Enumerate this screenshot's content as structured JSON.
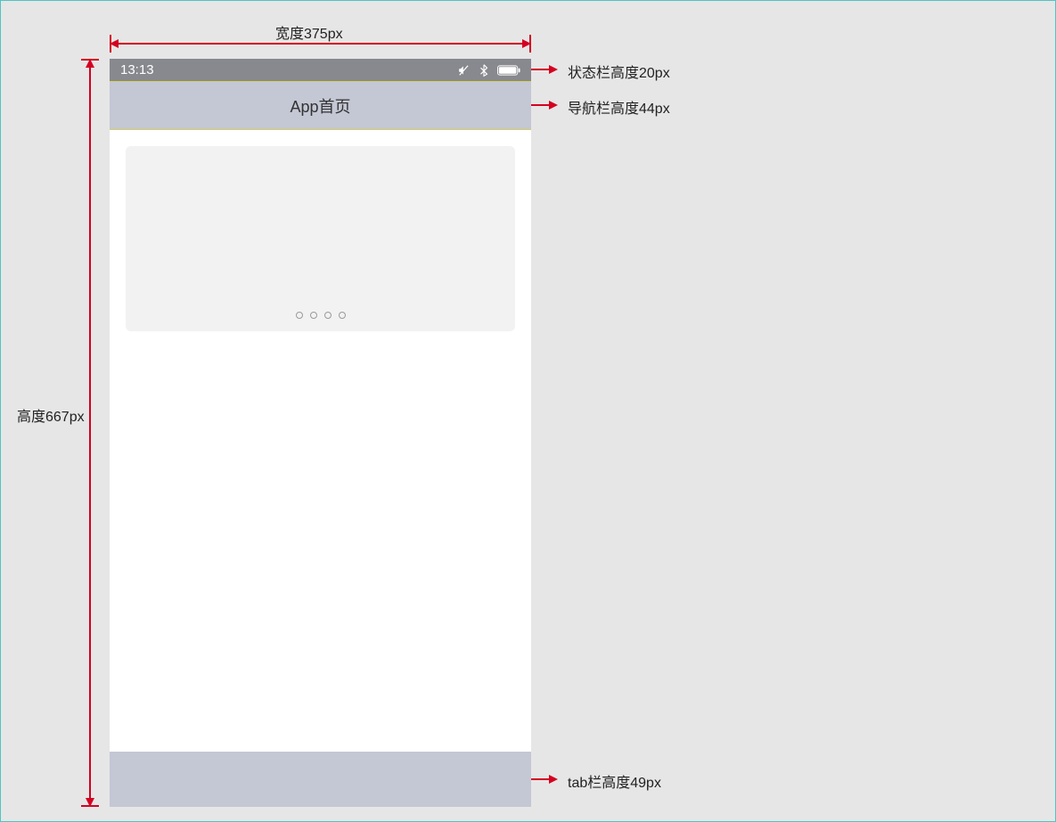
{
  "dimensions": {
    "width_label": "宽度375px",
    "height_label": "高度667px",
    "status_bar_label": "状态栏高度20px",
    "nav_bar_label": "导航栏高度44px",
    "tab_bar_label": "tab栏高度49px"
  },
  "phone": {
    "status_bar": {
      "time": "13:13"
    },
    "nav_bar": {
      "title": "App首页"
    },
    "carousel": {
      "dot_count": 4
    }
  }
}
